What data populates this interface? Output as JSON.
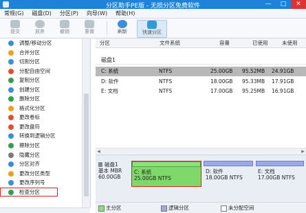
{
  "window": {
    "title": "分区助手PE版 - 无损分区免费软件",
    "minimize": "—",
    "maximize": "□",
    "close": "✕",
    "accent": "#1e82d8"
  },
  "menu": [
    "常规(G)",
    "磁盘(D)",
    "分区(P)",
    "向导(W)",
    "帮助(H)"
  ],
  "toolbar": [
    {
      "label": "提交",
      "icon": "commit-icon",
      "enabled": false
    },
    {
      "label": "放弃",
      "icon": "discard-icon",
      "enabled": false
    },
    {
      "label": "撤销",
      "icon": "undo-icon",
      "enabled": false
    },
    {
      "label": "重做",
      "icon": "redo-icon",
      "enabled": false
    },
    {
      "label": "刷新",
      "icon": "refresh-icon",
      "enabled": true
    },
    {
      "label": "快速分区",
      "icon": "quick-partition-icon",
      "enabled": true
    }
  ],
  "sidebar": {
    "items": [
      {
        "label": "调整/移动分区",
        "color": "#3b8fd8"
      },
      {
        "label": "合并分区",
        "color": "#f0a020"
      },
      {
        "label": "切割分区",
        "color": "#3b8fd8"
      },
      {
        "label": "分配自由空间",
        "color": "#e05030"
      },
      {
        "label": "复制分区",
        "color": "#30a050"
      },
      {
        "label": "创建分区",
        "color": "#3b8fd8"
      },
      {
        "label": "删除分区",
        "color": "#30a050"
      },
      {
        "label": "格式化分区",
        "color": "#f0a020"
      },
      {
        "label": "更改卷标",
        "color": "#e05030"
      },
      {
        "label": "更改盘符",
        "color": "#e05030"
      },
      {
        "label": "转换到逻辑分区",
        "color": "#3b8fd8"
      },
      {
        "label": "擦除分区",
        "color": "#30a050"
      },
      {
        "label": "隐藏分区",
        "color": "#7a7a7a"
      },
      {
        "label": "分区对齐",
        "color": "#3b8fd8"
      },
      {
        "label": "更改分区类型",
        "color": "#f0a020"
      },
      {
        "label": "更改序列号",
        "color": "#3b8fd8"
      },
      {
        "label": "检查分区",
        "color": "#30a050"
      }
    ]
  },
  "grid": {
    "columns": [
      "分区",
      "文件系统",
      "容量",
      "已使用",
      "未使用"
    ],
    "disk_header": "磁盘1",
    "rows": [
      {
        "partition": "C: 系统",
        "fs": "NTFS",
        "capacity": "25.00GB",
        "used": "95.52MB",
        "free": "24.91GB",
        "selected": true
      },
      {
        "partition": "D: 软件",
        "fs": "NTFS",
        "capacity": "18.00GB",
        "used": "95.33MB",
        "free": "17.91GB",
        "selected": false
      },
      {
        "partition": "E: 文档",
        "fs": "NTFS",
        "capacity": "17.00GB",
        "used": "95.25MB",
        "free": "16.91GB",
        "selected": false
      }
    ]
  },
  "diskmap": {
    "disk_name": "磁盘1",
    "disk_type": "基本 MBR",
    "disk_size": "60.00GB",
    "partitions": [
      {
        "name": "C: 系统",
        "detail": "25.00GB NTFS",
        "selected": true
      },
      {
        "name": "D: 软件",
        "detail": "18.00GB NTFS",
        "selected": false
      },
      {
        "name": "E: 文档",
        "detail": "17.00GB NTFS",
        "selected": false
      }
    ]
  },
  "legend": [
    {
      "label": "主分区",
      "color": "#8fe07a"
    },
    {
      "label": "逻辑分区",
      "color": "#9da8e6"
    },
    {
      "label": "未分配空间",
      "color": "#ffffff"
    }
  ]
}
